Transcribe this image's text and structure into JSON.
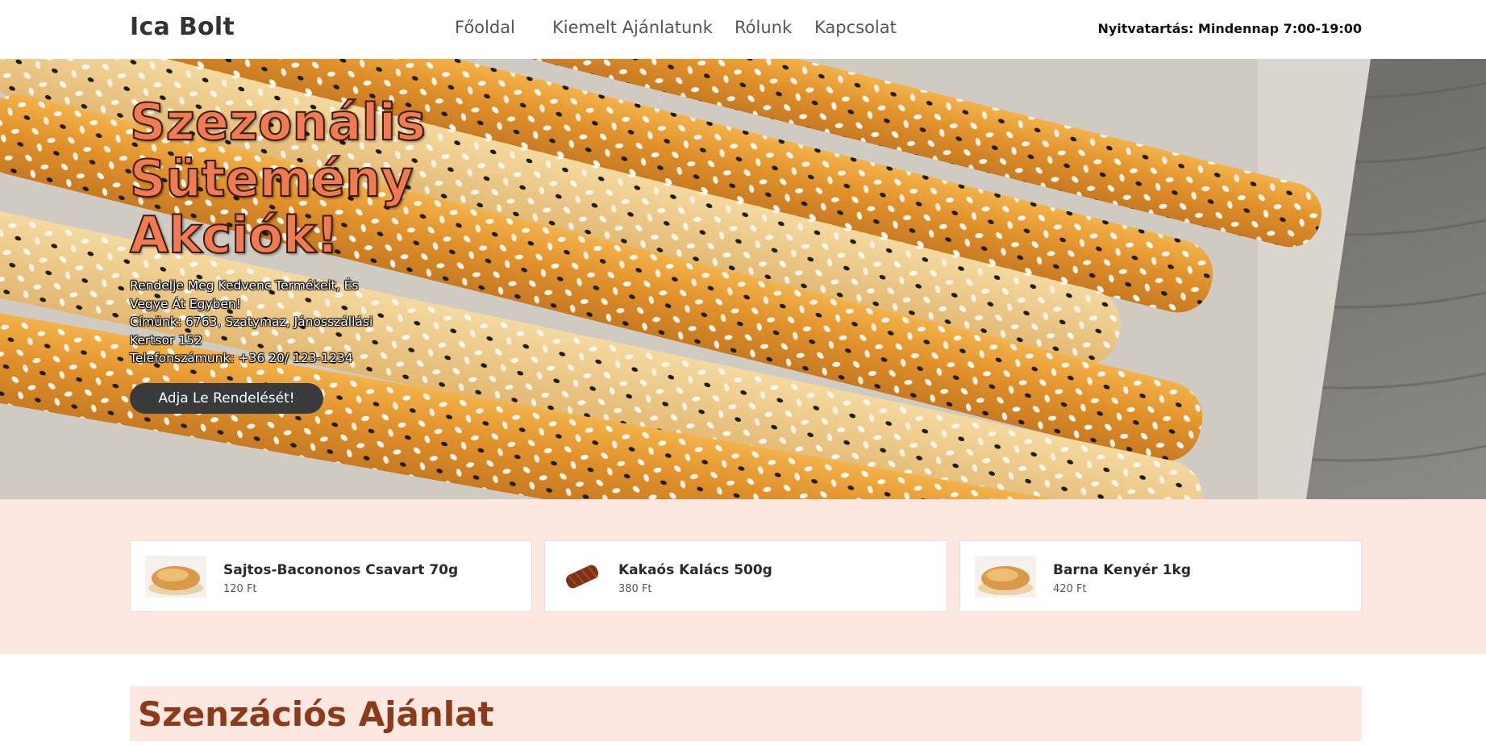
{
  "header": {
    "brand": "Ica Bolt",
    "nav": [
      "Főoldal",
      "Kiemelt Ajánlatunk",
      "Rólunk",
      "Kapcsolat"
    ],
    "hours": "Nyitvatartás: Mindennap 7:00-19:00"
  },
  "hero": {
    "title": "Szezonális Sütemény Akciók!",
    "info_lines": [
      "Rendelje Meg Kedvenc Termékeit, És Vegye Át Egyben!",
      "Címünk: 6763, Szatymaz, Jánosszállási Kertsor 152",
      "Telefonszámunk: +36 20/ 123-1234"
    ],
    "cta": "Adja Le Rendelését!"
  },
  "products": [
    {
      "name": "Sajtos-Bacononos Csavart 70g",
      "price": "120 Ft"
    },
    {
      "name": "Kakaós Kalács 500g",
      "price": "380 Ft"
    },
    {
      "name": "Barna Kenyér 1kg",
      "price": "420 Ft"
    }
  ],
  "section": {
    "title": "Szenzációs Ajánlat"
  },
  "colors": {
    "accent": "#ef7b52",
    "strip_bg": "#fde8e1",
    "section_title": "#8b3a1a",
    "button": "#3a3a3c"
  }
}
